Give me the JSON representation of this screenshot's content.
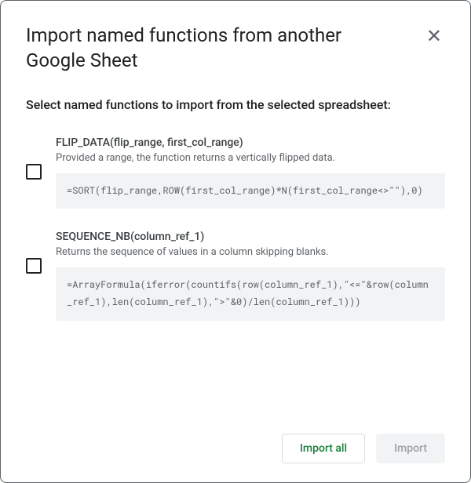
{
  "dialog": {
    "title": "Import named functions from another Google Sheet",
    "subtitle": "Select named functions to import from the selected spreadsheet:"
  },
  "functions": [
    {
      "signature": "FLIP_DATA(flip_range, first_col_range)",
      "description": "Provided a range, the function returns a vertically flipped data.",
      "formula": "=SORT(flip_range,ROW(first_col_range)*N(first_col_range<>\"\"),0)"
    },
    {
      "signature": "SEQUENCE_NB(column_ref_1)",
      "description": "Returns the sequence of values in a column skipping blanks.",
      "formula": "=ArrayFormula(iferror(countifs(row(column_ref_1),\"<=\"&row(column_ref_1),len(column_ref_1),\">\"&0)/len(column_ref_1)))"
    }
  ],
  "buttons": {
    "import_all": "Import all",
    "import": "Import"
  },
  "icons": {
    "close": "✕"
  }
}
